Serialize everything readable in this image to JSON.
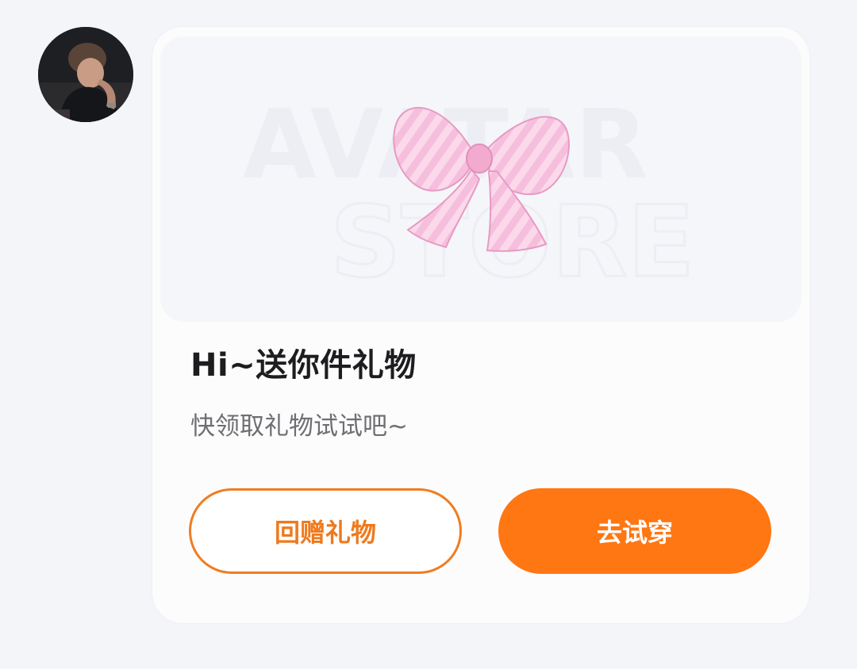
{
  "message": {
    "sender_avatar": "avatar",
    "banner": {
      "watermark_line1": "AVATAR",
      "watermark_line2": "STORE",
      "gift_icon": "bow-icon",
      "gift_color": "#f4b3d6"
    },
    "title": "Hi~送你件礼物",
    "subtitle": "快领取礼物试试吧~",
    "buttons": {
      "return_gift_label": "回赠礼物",
      "try_on_label": "去试穿"
    },
    "colors": {
      "accent": "#ff7712",
      "accent_outline": "#ef7d22",
      "page_background": "#f4f5f9",
      "card_background": "#fcfcfd"
    }
  }
}
